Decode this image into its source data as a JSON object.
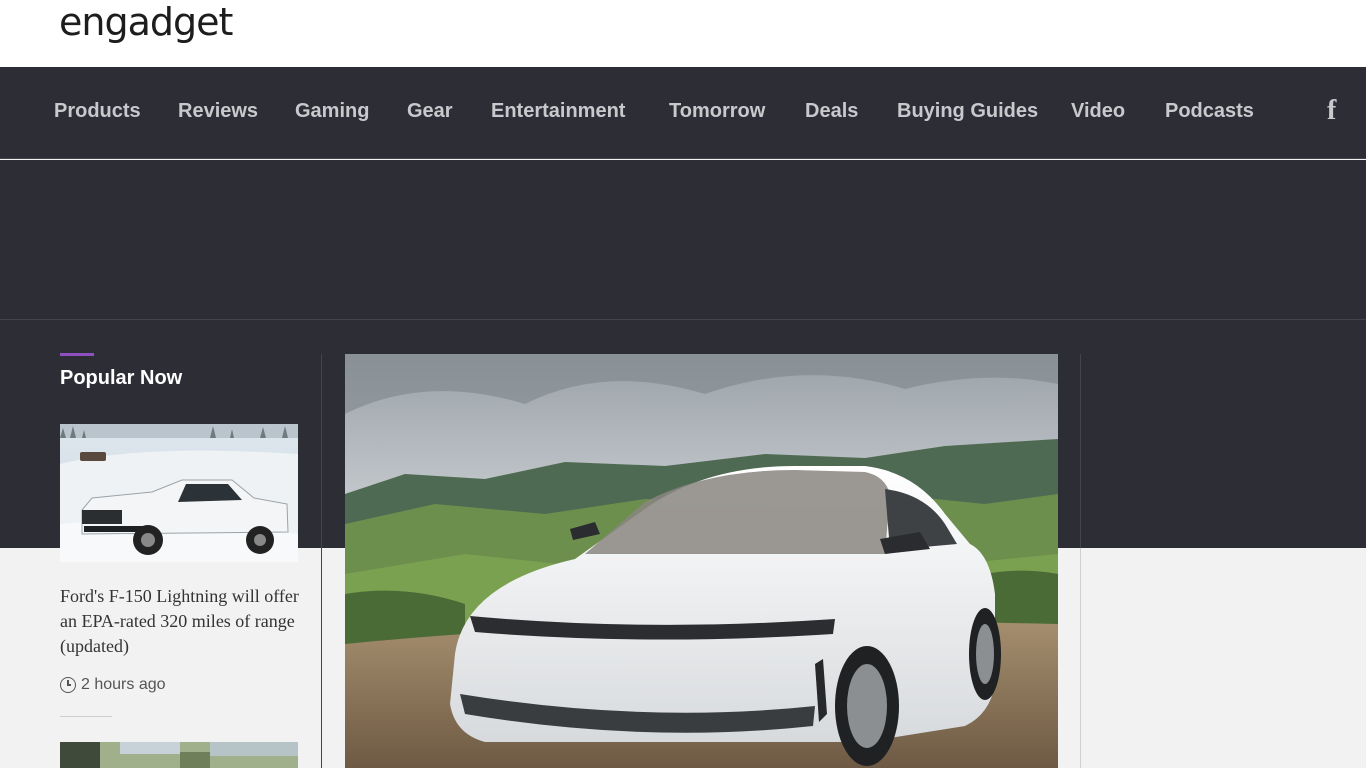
{
  "site": {
    "logo_text": "engadget"
  },
  "nav": {
    "items": [
      {
        "label": "Products"
      },
      {
        "label": "Reviews"
      },
      {
        "label": "Gaming"
      },
      {
        "label": "Gear"
      },
      {
        "label": "Entertainment"
      },
      {
        "label": "Tomorrow"
      },
      {
        "label": "Deals"
      },
      {
        "label": "Buying Guides"
      },
      {
        "label": "Video"
      },
      {
        "label": "Podcasts"
      }
    ],
    "social_icon": "facebook-icon",
    "social_glyph": "f"
  },
  "popular": {
    "title": "Popular Now",
    "accent_color": "#8e4fc1",
    "stories": [
      {
        "title": "Ford's F-150 Lightning will offer an EPA-rated 320 miles of range (updated)",
        "time": "2 hours ago",
        "image_icon": "pickup-truck-photo"
      }
    ]
  },
  "hero": {
    "image_icon": "white-electric-sedan-photo"
  },
  "colors": {
    "nav_bg": "#2d2e35",
    "page_bg": "#f2f2f2"
  }
}
